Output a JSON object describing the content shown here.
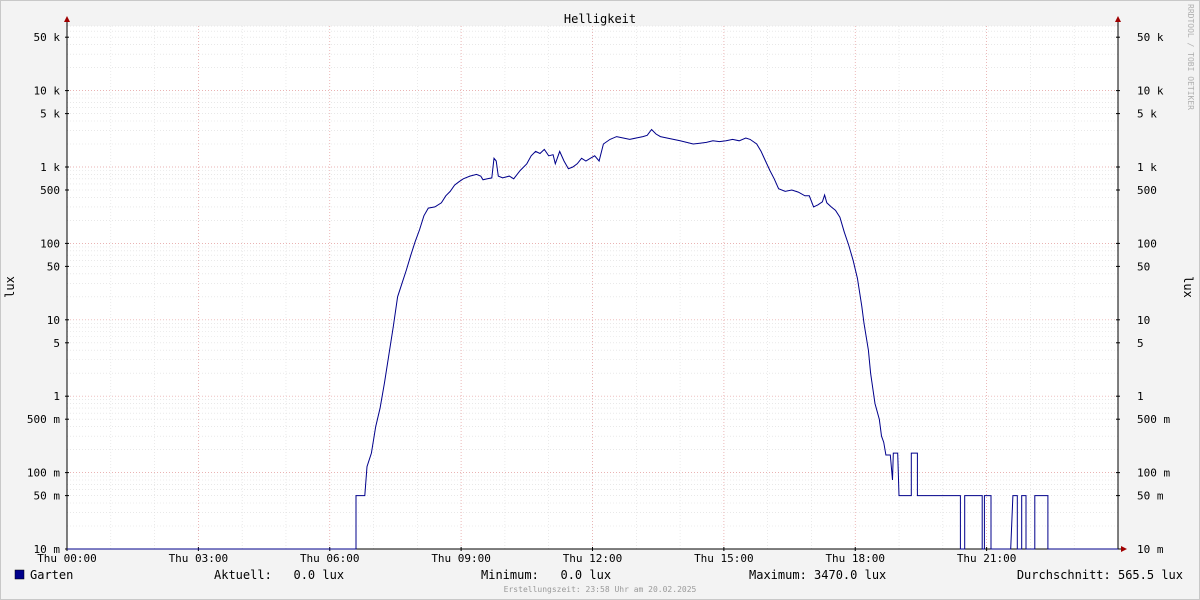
{
  "chart_data": {
    "type": "line",
    "title": "Helligkeit",
    "ylabel": "lux",
    "yscale": "log",
    "ylim": [
      0.01,
      80000
    ],
    "xlim": [
      0,
      24
    ],
    "grid": true,
    "x_tick_labels": [
      {
        "x": 0,
        "label": "Thu 00:00"
      },
      {
        "x": 3,
        "label": "Thu 03:00"
      },
      {
        "x": 6,
        "label": "Thu 06:00"
      },
      {
        "x": 9,
        "label": "Thu 09:00"
      },
      {
        "x": 12,
        "label": "Thu 12:00"
      },
      {
        "x": 15,
        "label": "Thu 15:00"
      },
      {
        "x": 18,
        "label": "Thu 18:00"
      },
      {
        "x": 21,
        "label": "Thu 21:00"
      }
    ],
    "y_tick_labels": [
      {
        "v": 0.01,
        "label": "10 m"
      },
      {
        "v": 0.05,
        "label": "50 m"
      },
      {
        "v": 0.1,
        "label": "100 m"
      },
      {
        "v": 0.5,
        "label": "500 m"
      },
      {
        "v": 1,
        "label": "1"
      },
      {
        "v": 5,
        "label": "5"
      },
      {
        "v": 10,
        "label": "10"
      },
      {
        "v": 50,
        "label": "50"
      },
      {
        "v": 100,
        "label": "100"
      },
      {
        "v": 500,
        "label": "500"
      },
      {
        "v": 1000,
        "label": "1 k"
      },
      {
        "v": 5000,
        "label": "5 k"
      },
      {
        "v": 10000,
        "label": "10 k"
      },
      {
        "v": 50000,
        "label": "50 k"
      }
    ],
    "series": [
      {
        "name": "Garten",
        "color": "#00008b",
        "points": [
          [
            0.0,
            0.01
          ],
          [
            6.6,
            0.01
          ],
          [
            6.6,
            0.05
          ],
          [
            6.8,
            0.05
          ],
          [
            6.85,
            0.12
          ],
          [
            6.95,
            0.18
          ],
          [
            7.05,
            0.4
          ],
          [
            7.15,
            0.7
          ],
          [
            7.25,
            1.5
          ],
          [
            7.35,
            3.5
          ],
          [
            7.45,
            8
          ],
          [
            7.55,
            20
          ],
          [
            7.65,
            30
          ],
          [
            7.75,
            45
          ],
          [
            7.85,
            70
          ],
          [
            7.95,
            105
          ],
          [
            8.05,
            150
          ],
          [
            8.15,
            230
          ],
          [
            8.25,
            290
          ],
          [
            8.4,
            300
          ],
          [
            8.55,
            340
          ],
          [
            8.65,
            420
          ],
          [
            8.75,
            480
          ],
          [
            8.85,
            580
          ],
          [
            8.95,
            640
          ],
          [
            9.05,
            700
          ],
          [
            9.2,
            760
          ],
          [
            9.35,
            800
          ],
          [
            9.45,
            760
          ],
          [
            9.5,
            680
          ],
          [
            9.6,
            700
          ],
          [
            9.7,
            720
          ],
          [
            9.75,
            1300
          ],
          [
            9.8,
            1200
          ],
          [
            9.85,
            760
          ],
          [
            9.95,
            720
          ],
          [
            10.1,
            760
          ],
          [
            10.2,
            700
          ],
          [
            10.35,
            900
          ],
          [
            10.5,
            1100
          ],
          [
            10.6,
            1400
          ],
          [
            10.7,
            1600
          ],
          [
            10.8,
            1500
          ],
          [
            10.9,
            1700
          ],
          [
            11.0,
            1400
          ],
          [
            11.1,
            1450
          ],
          [
            11.15,
            1100
          ],
          [
            11.25,
            1600
          ],
          [
            11.35,
            1200
          ],
          [
            11.45,
            950
          ],
          [
            11.55,
            1000
          ],
          [
            11.65,
            1100
          ],
          [
            11.75,
            1300
          ],
          [
            11.85,
            1200
          ],
          [
            11.95,
            1300
          ],
          [
            12.05,
            1400
          ],
          [
            12.15,
            1200
          ],
          [
            12.25,
            2000
          ],
          [
            12.4,
            2300
          ],
          [
            12.55,
            2500
          ],
          [
            12.7,
            2400
          ],
          [
            12.85,
            2300
          ],
          [
            13.0,
            2400
          ],
          [
            13.15,
            2500
          ],
          [
            13.25,
            2600
          ],
          [
            13.35,
            3100
          ],
          [
            13.45,
            2700
          ],
          [
            13.55,
            2500
          ],
          [
            13.7,
            2400
          ],
          [
            13.85,
            2300
          ],
          [
            14.0,
            2200
          ],
          [
            14.15,
            2100
          ],
          [
            14.3,
            2000
          ],
          [
            14.45,
            2050
          ],
          [
            14.6,
            2100
          ],
          [
            14.75,
            2200
          ],
          [
            14.9,
            2150
          ],
          [
            15.05,
            2200
          ],
          [
            15.2,
            2300
          ],
          [
            15.35,
            2200
          ],
          [
            15.5,
            2400
          ],
          [
            15.6,
            2300
          ],
          [
            15.75,
            2000
          ],
          [
            15.85,
            1600
          ],
          [
            15.95,
            1200
          ],
          [
            16.05,
            900
          ],
          [
            16.15,
            700
          ],
          [
            16.25,
            520
          ],
          [
            16.4,
            480
          ],
          [
            16.55,
            500
          ],
          [
            16.7,
            470
          ],
          [
            16.85,
            420
          ],
          [
            16.95,
            420
          ],
          [
            17.05,
            300
          ],
          [
            17.15,
            320
          ],
          [
            17.25,
            350
          ],
          [
            17.3,
            430
          ],
          [
            17.35,
            340
          ],
          [
            17.45,
            300
          ],
          [
            17.55,
            270
          ],
          [
            17.65,
            220
          ],
          [
            17.75,
            140
          ],
          [
            17.85,
            95
          ],
          [
            17.95,
            60
          ],
          [
            18.05,
            35
          ],
          [
            18.15,
            15
          ],
          [
            18.2,
            9
          ],
          [
            18.3,
            4
          ],
          [
            18.35,
            2
          ],
          [
            18.45,
            0.8
          ],
          [
            18.55,
            0.5
          ],
          [
            18.6,
            0.3
          ],
          [
            18.65,
            0.25
          ],
          [
            18.7,
            0.17
          ],
          [
            18.8,
            0.17
          ],
          [
            18.85,
            0.08
          ],
          [
            18.87,
            0.18
          ],
          [
            18.97,
            0.18
          ],
          [
            19.0,
            0.05
          ],
          [
            19.28,
            0.05
          ],
          [
            19.28,
            0.18
          ],
          [
            19.42,
            0.18
          ],
          [
            19.42,
            0.05
          ],
          [
            20.4,
            0.05
          ],
          [
            20.4,
            0.01
          ],
          [
            20.5,
            0.01
          ],
          [
            20.5,
            0.05
          ],
          [
            20.9,
            0.05
          ],
          [
            20.9,
            0.01
          ],
          [
            20.95,
            0.01
          ],
          [
            20.95,
            0.05
          ],
          [
            21.1,
            0.05
          ],
          [
            21.1,
            0.01
          ],
          [
            21.55,
            0.01
          ],
          [
            21.6,
            0.05
          ],
          [
            21.7,
            0.05
          ],
          [
            21.7,
            0.01
          ],
          [
            21.8,
            0.01
          ],
          [
            21.8,
            0.05
          ],
          [
            21.9,
            0.05
          ],
          [
            21.9,
            0.01
          ],
          [
            22.1,
            0.01
          ],
          [
            22.1,
            0.05
          ],
          [
            22.4,
            0.05
          ],
          [
            22.4,
            0.01
          ],
          [
            24.0,
            0.01
          ]
        ]
      }
    ]
  },
  "watermark": "RRDTOOL / TOBI OETIKER",
  "legend": {
    "series_name": "Garten",
    "series_color": "#00008b",
    "current": "Aktuell:   0.0 lux",
    "minimum": "Minimum:   0.0 lux",
    "maximum": "Maximum: 3470.0 lux",
    "average": "Durchschnitt: 565.5 lux"
  },
  "footer": "Erstellungszeit: 23:58 Uhr am 20.02.2025"
}
